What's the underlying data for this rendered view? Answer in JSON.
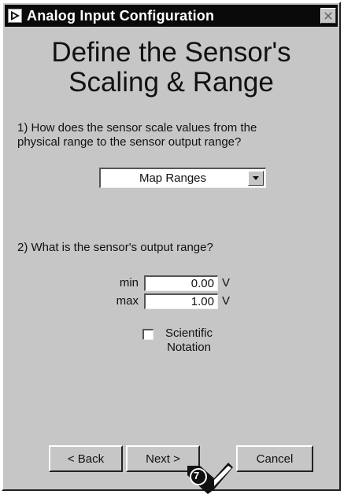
{
  "window": {
    "title": "Analog Input Configuration",
    "close_glyph": "✕"
  },
  "heading": {
    "line1": "Define the Sensor's",
    "line2": "Scaling & Range"
  },
  "question1": {
    "line1": "1)  How does the sensor scale values from the",
    "line2": "physical range to the sensor output range?"
  },
  "scaling_select": {
    "value": "Map Ranges"
  },
  "question2": {
    "text": "2) What is the sensor's output range?"
  },
  "output_range": {
    "min_label": "min",
    "min_value": "0.00",
    "max_label": "max",
    "max_value": "1.00",
    "unit": "V"
  },
  "scientific": {
    "line1": "Scientific",
    "line2": "Notation",
    "checked": false
  },
  "buttons": {
    "back": "< Back",
    "next": "Next >",
    "cancel": "Cancel"
  },
  "callout": {
    "number": "7"
  },
  "icons": {
    "app": "labview-arrow-icon",
    "close": "close-icon",
    "dropdown": "chevron-down-icon"
  },
  "colors": {
    "window_bg": "#c6c6c6",
    "titlebar_bg": "#0a0a0a",
    "field_bg": "#ffffff"
  }
}
